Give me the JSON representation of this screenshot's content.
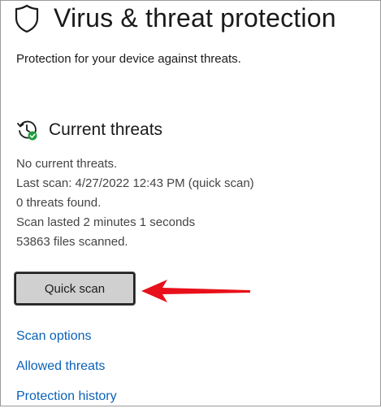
{
  "header": {
    "title": "Virus & threat protection",
    "subtitle": "Protection for your device against threats.",
    "icon": "shield-icon"
  },
  "current_threats": {
    "title": "Current threats",
    "icon": "history-check-icon",
    "status": "No current threats.",
    "last_scan": "Last scan: 4/27/2022 12:43 PM (quick scan)",
    "threats_found": "0 threats found.",
    "scan_duration": "Scan lasted 2 minutes 1 seconds",
    "files_scanned": "53863 files scanned."
  },
  "actions": {
    "quick_scan_label": "Quick scan"
  },
  "links": {
    "scan_options": "Scan options",
    "allowed_threats": "Allowed threats",
    "protection_history": "Protection history"
  },
  "colors": {
    "link": "#0a62b8",
    "button_bg": "#d0d0d0",
    "annotation_arrow": "#e8101a",
    "status_ok": "#1e9e3c"
  }
}
